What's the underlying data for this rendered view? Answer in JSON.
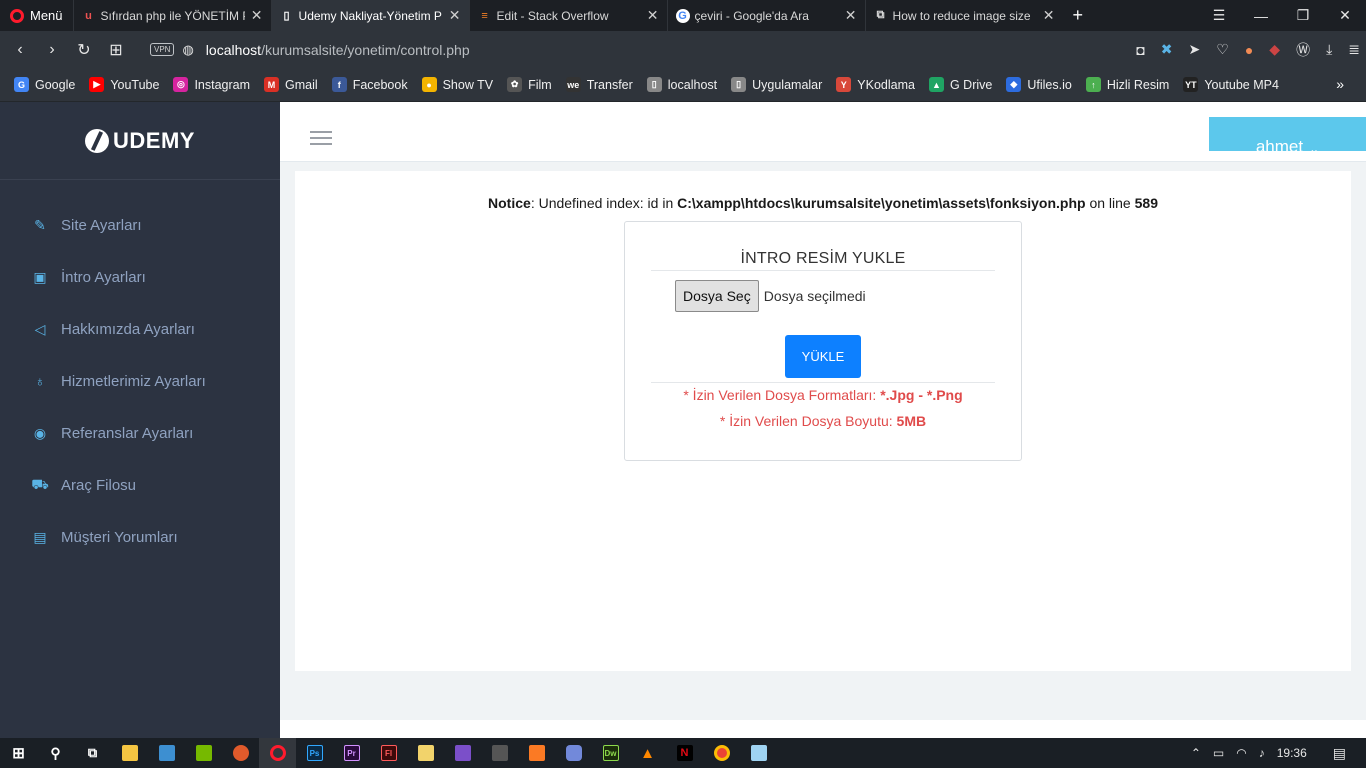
{
  "browser": {
    "menu_label": "Menü",
    "tabs": [
      {
        "title": "Sıfırdan php ile YÖNETİM P",
        "icon": "udemy-icon",
        "active": false
      },
      {
        "title": "Udemy Nakliyat-Yönetim P",
        "icon": "page-icon",
        "active": true
      },
      {
        "title": "Edit - Stack Overflow",
        "icon": "stackoverflow-icon",
        "active": false
      },
      {
        "title": "çeviri - Google'da Ara",
        "icon": "google-icon",
        "active": false
      },
      {
        "title": "How to reduce image size",
        "icon": "stackexchange-icon",
        "active": false
      }
    ],
    "vpn_label": "VPN",
    "url_host": "localhost",
    "url_path": "/kurumsalsite/yonetim/control.php",
    "bookmarks": [
      {
        "label": "Google",
        "color": "#4285f4",
        "glyph": "G"
      },
      {
        "label": "YouTube",
        "color": "#ff0000",
        "glyph": "▶"
      },
      {
        "label": "Instagram",
        "color": "#d6249f",
        "glyph": "◎"
      },
      {
        "label": "Gmail",
        "color": "#d93025",
        "glyph": "M"
      },
      {
        "label": "Facebook",
        "color": "#3b5998",
        "glyph": "f"
      },
      {
        "label": "Show TV",
        "color": "#f4b400",
        "glyph": "●"
      },
      {
        "label": "Film",
        "color": "#555555",
        "glyph": "✿"
      },
      {
        "label": "Transfer",
        "color": "#333333",
        "glyph": "we"
      },
      {
        "label": "localhost",
        "color": "#888888",
        "glyph": "▯"
      },
      {
        "label": "Uygulamalar",
        "color": "#888888",
        "glyph": "▯"
      },
      {
        "label": "YKodlama",
        "color": "#d8483a",
        "glyph": "Y"
      },
      {
        "label": "G Drive",
        "color": "#1fa463",
        "glyph": "▲"
      },
      {
        "label": "Ufiles.io",
        "color": "#2d6cdf",
        "glyph": "◆"
      },
      {
        "label": "Hizli Resim",
        "color": "#4caf50",
        "glyph": "↑"
      },
      {
        "label": "Youtube MP4",
        "color": "#222222",
        "glyph": "YT"
      }
    ]
  },
  "sidebar": {
    "brand": "UDEMY",
    "items": [
      {
        "label": "Site Ayarları",
        "icon": "pencil-icon",
        "glyph": "✎"
      },
      {
        "label": "İntro Ayarları",
        "icon": "image-icon",
        "glyph": "▣"
      },
      {
        "label": "Hakkımızda Ayarları",
        "icon": "send-icon",
        "glyph": "◁"
      },
      {
        "label": "Hizmetlerimiz Ayarları",
        "icon": "bulb-icon",
        "glyph": "♁"
      },
      {
        "label": "Referanslar Ayarları",
        "icon": "eye-icon",
        "glyph": "◉"
      },
      {
        "label": "Araç Filosu",
        "icon": "car-icon",
        "glyph": "⛟"
      },
      {
        "label": "Müşteri Yorumları",
        "icon": "comment-icon",
        "glyph": "▤"
      }
    ]
  },
  "header": {
    "user": "ahmet"
  },
  "notice": {
    "label": "Notice",
    "message": ": Undefined index: id in ",
    "path": "C:\\xampp\\htdocs\\kurumsalsite\\yonetim\\assets\\fonksiyon.php",
    "line_text": " on line ",
    "line": "589"
  },
  "upload_card": {
    "title": "İNTRO RESİM YUKLE",
    "file_button": "Dosya Seç",
    "file_status": "Dosya seçilmedi",
    "submit": "YÜKLE",
    "formats_label": "* İzin Verilen Dosya Formatları: ",
    "formats_value": "*.Jpg - *.Png",
    "size_label": "* İzin Verilen Dosya Boyutu: ",
    "size_value": "5MB"
  },
  "taskbar": {
    "time": "19:36"
  }
}
